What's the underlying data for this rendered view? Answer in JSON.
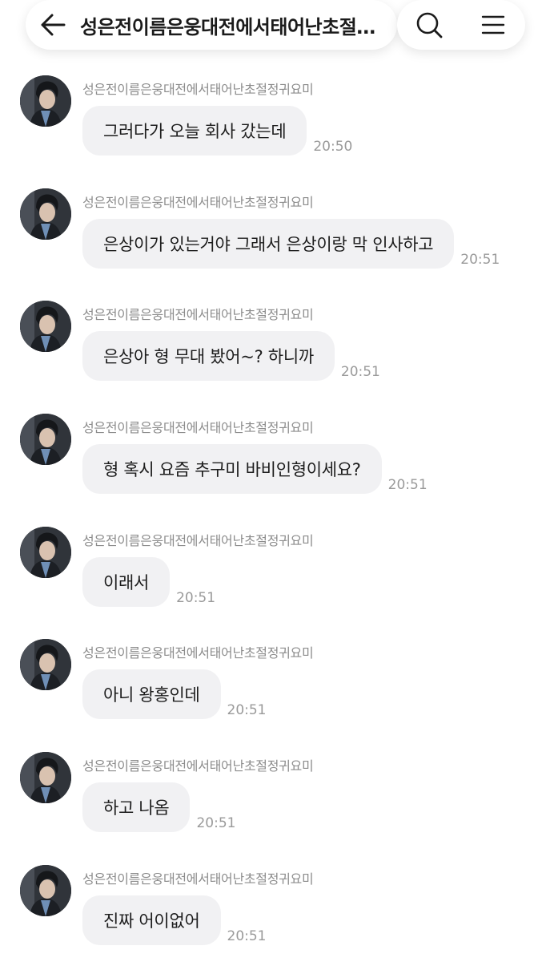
{
  "header": {
    "title": "성은전이름은웅대전에서태어난초절정귀요미",
    "back_icon": "arrow-left-icon",
    "search_icon": "search-icon",
    "menu_icon": "menu-icon"
  },
  "messages": [
    {
      "sender": "성은전이름은웅대전에서태어난초절정귀요미",
      "text": "그러다가 오늘 회사 갔는데",
      "time": "20:50"
    },
    {
      "sender": "성은전이름은웅대전에서태어난초절정귀요미",
      "text": "은상이가 있는거야 그래서 은상이랑 막 인사하고",
      "time": "20:51"
    },
    {
      "sender": "성은전이름은웅대전에서태어난초절정귀요미",
      "text": "은상아 형 무대 봤어~? 하니까",
      "time": "20:51"
    },
    {
      "sender": "성은전이름은웅대전에서태어난초절정귀요미",
      "text": "형 혹시 요즘 추구미 바비인형이세요?",
      "time": "20:51"
    },
    {
      "sender": "성은전이름은웅대전에서태어난초절정귀요미",
      "text": "이래서",
      "time": "20:51"
    },
    {
      "sender": "성은전이름은웅대전에서태어난초절정귀요미",
      "text": "아니 왕홍인데",
      "time": "20:51"
    },
    {
      "sender": "성은전이름은웅대전에서태어난초절정귀요미",
      "text": "하고 나옴",
      "time": "20:51"
    },
    {
      "sender": "성은전이름은웅대전에서태어난초절정귀요미",
      "text": "진짜 어이없어",
      "time": "20:51"
    }
  ]
}
